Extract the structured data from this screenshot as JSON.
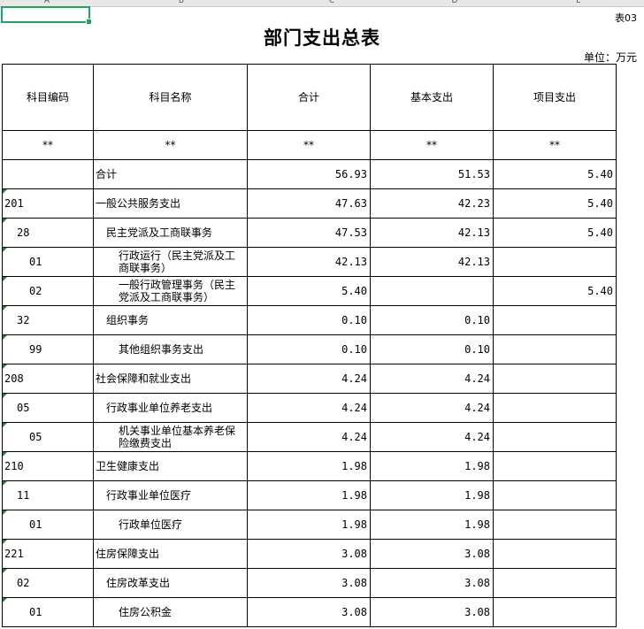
{
  "sheet": {
    "column_letters": [
      "A",
      "B",
      "C",
      "D",
      "E"
    ],
    "table_no": "表03",
    "title": "部门支出总表",
    "unit": "单位：万元"
  },
  "table": {
    "headers": [
      "科目编码",
      "科目名称",
      "合计",
      "基本支出",
      "项目支出"
    ],
    "star_row": [
      "**",
      "**",
      "**",
      "**",
      "**"
    ],
    "rows": [
      {
        "code": "",
        "level": 0,
        "name": "合计",
        "total": "56.93",
        "basic": "51.53",
        "project": "5.40"
      },
      {
        "code": "201",
        "level": 1,
        "name": "一般公共服务支出",
        "total": "47.63",
        "basic": "42.23",
        "project": "5.40"
      },
      {
        "code": "28",
        "level": 2,
        "name": "民主党派及工商联事务",
        "total": "47.53",
        "basic": "42.13",
        "project": "5.40"
      },
      {
        "code": "01",
        "level": 3,
        "name": "行政运行（民主党派及工商联事务）",
        "total": "42.13",
        "basic": "42.13",
        "project": ""
      },
      {
        "code": "02",
        "level": 3,
        "name": "一般行政管理事务（民主党派及工商联事务）",
        "total": "5.40",
        "basic": "",
        "project": "5.40"
      },
      {
        "code": "32",
        "level": 2,
        "name": "组织事务",
        "total": "0.10",
        "basic": "0.10",
        "project": ""
      },
      {
        "code": "99",
        "level": 3,
        "name": "其他组织事务支出",
        "total": "0.10",
        "basic": "0.10",
        "project": ""
      },
      {
        "code": "208",
        "level": 1,
        "name": "社会保障和就业支出",
        "total": "4.24",
        "basic": "4.24",
        "project": ""
      },
      {
        "code": "05",
        "level": 2,
        "name": "行政事业单位养老支出",
        "total": "4.24",
        "basic": "4.24",
        "project": ""
      },
      {
        "code": "05",
        "level": 3,
        "name": "机关事业单位基本养老保险缴费支出",
        "total": "4.24",
        "basic": "4.24",
        "project": ""
      },
      {
        "code": "210",
        "level": 1,
        "name": "卫生健康支出",
        "total": "1.98",
        "basic": "1.98",
        "project": ""
      },
      {
        "code": "11",
        "level": 2,
        "name": "行政事业单位医疗",
        "total": "1.98",
        "basic": "1.98",
        "project": ""
      },
      {
        "code": "01",
        "level": 3,
        "name": "行政单位医疗",
        "total": "1.98",
        "basic": "1.98",
        "project": ""
      },
      {
        "code": "221",
        "level": 1,
        "name": "住房保障支出",
        "total": "3.08",
        "basic": "3.08",
        "project": ""
      },
      {
        "code": "02",
        "level": 2,
        "name": "住房改革支出",
        "total": "3.08",
        "basic": "3.08",
        "project": ""
      },
      {
        "code": "01",
        "level": 3,
        "name": "住房公积金",
        "total": "3.08",
        "basic": "3.08",
        "project": ""
      }
    ]
  }
}
